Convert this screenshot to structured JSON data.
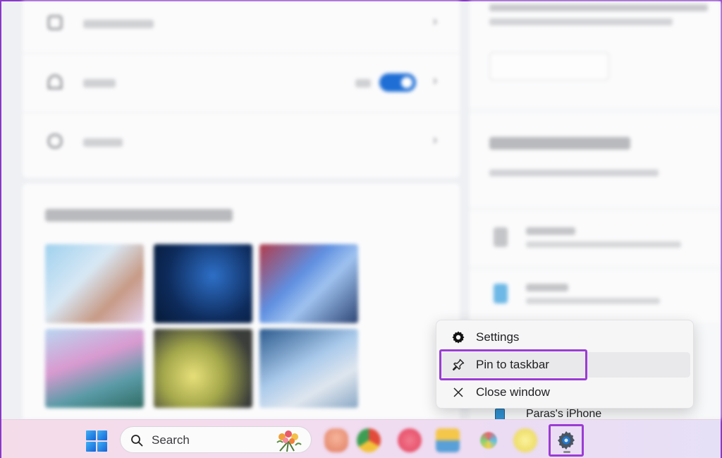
{
  "context_menu": {
    "items": [
      {
        "label": "Settings",
        "icon": "gear-icon"
      },
      {
        "label": "Pin to taskbar",
        "icon": "pin-icon"
      },
      {
        "label": "Close window",
        "icon": "close-icon"
      }
    ]
  },
  "background_device": {
    "label": "Paras's iPhone"
  },
  "taskbar": {
    "search_label": "Search",
    "apps": [
      "start-icon",
      "search-icon",
      "app-icon",
      "chrome-icon",
      "app-icon",
      "app-icon",
      "app-icon",
      "app-icon",
      "settings-gear-icon"
    ]
  },
  "colors": {
    "highlight": "#9b3cd3",
    "toggle_on": "#1e6ed6"
  }
}
